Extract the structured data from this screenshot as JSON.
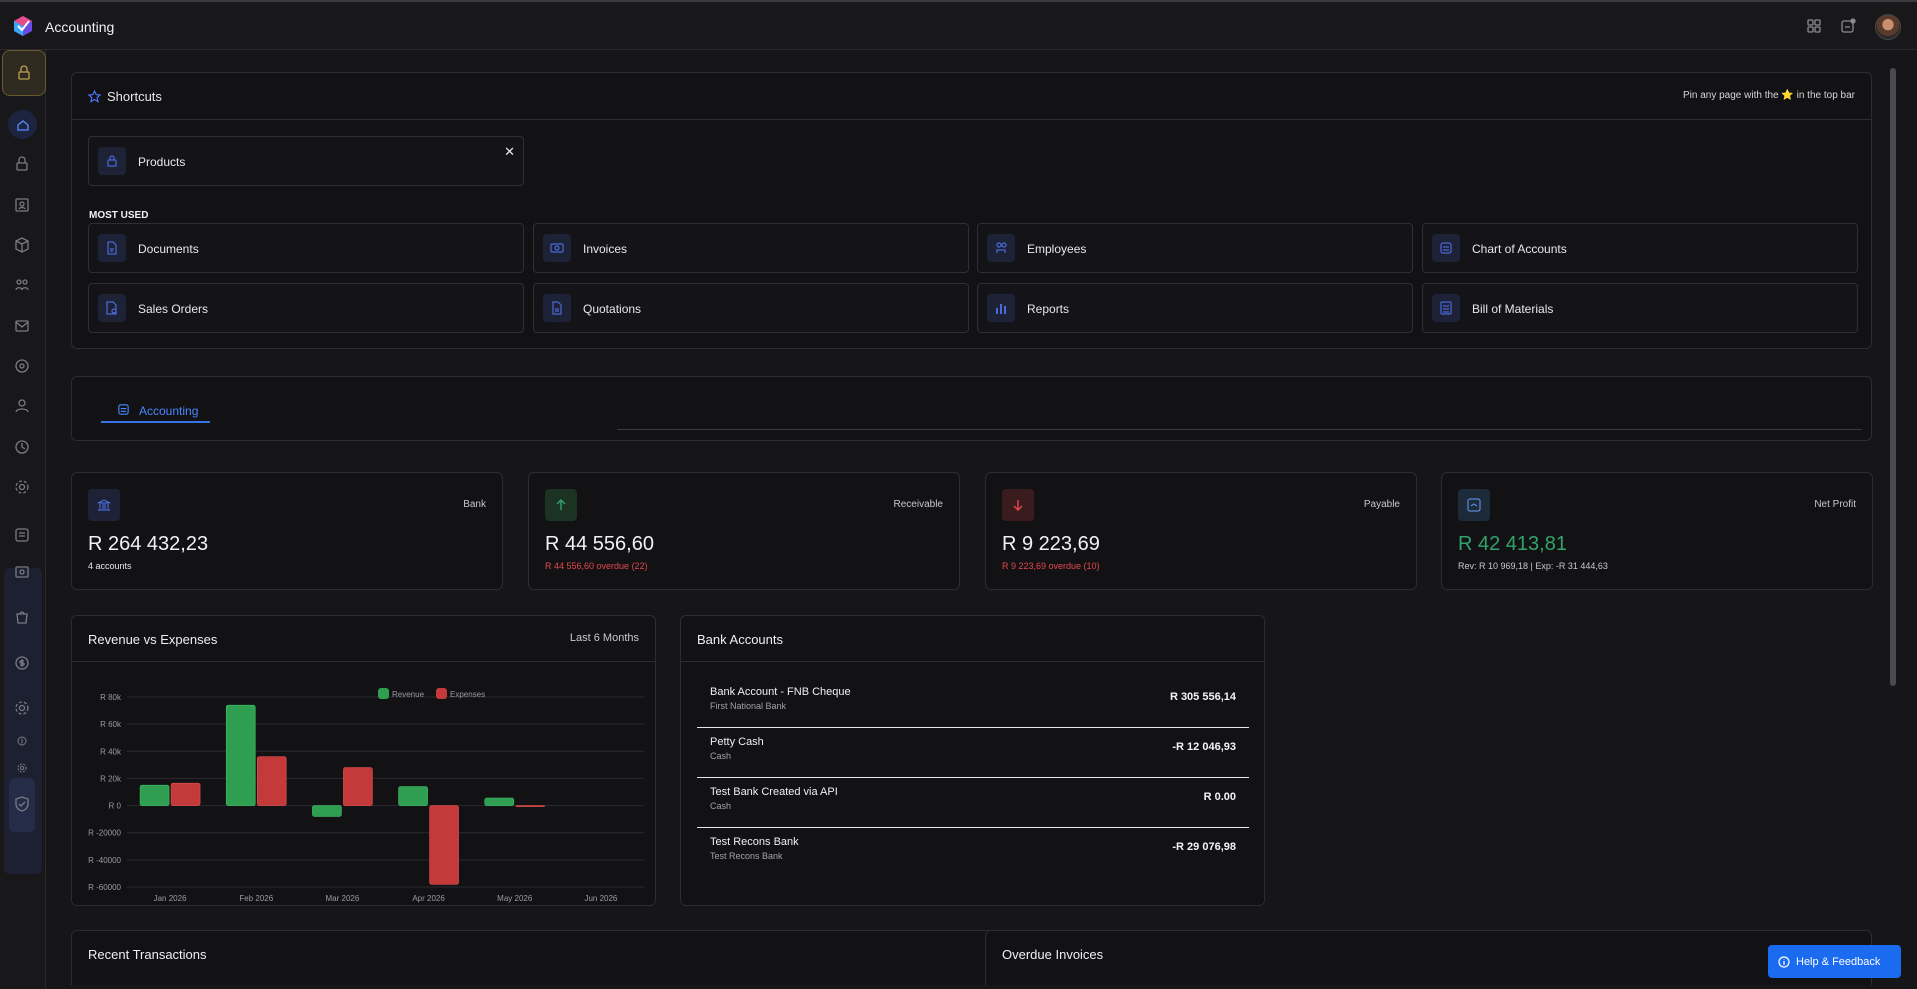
{
  "app": {
    "title": "Accounting"
  },
  "shortcuts": {
    "title": "Shortcuts",
    "hint": "Pin any page with the ⭐ in the top bar",
    "pinned": [
      {
        "label": "Products",
        "icon": "lock-icon"
      }
    ],
    "most_used_label": "MOST USED",
    "most_used": [
      {
        "label": "Documents",
        "icon": "document-icon"
      },
      {
        "label": "Invoices",
        "icon": "invoice-icon"
      },
      {
        "label": "Employees",
        "icon": "people-icon"
      },
      {
        "label": "Chart of Accounts",
        "icon": "ledger-icon"
      },
      {
        "label": "Sales Orders",
        "icon": "sales-order-icon"
      },
      {
        "label": "Quotations",
        "icon": "quotation-icon"
      },
      {
        "label": "Reports",
        "icon": "bar-chart-icon"
      },
      {
        "label": "Bill of Materials",
        "icon": "list-icon"
      }
    ]
  },
  "tabs": [
    {
      "label": "Accounting"
    }
  ],
  "stats": [
    {
      "label": "Bank",
      "value": "R 264 432,23",
      "sub": "4 accounts",
      "color": "#e8e8ea"
    },
    {
      "label": "Receivable",
      "value": "R 44 556,60",
      "sub": "R 44 556,60 overdue (22)",
      "color": "#e5484d"
    },
    {
      "label": "Payable",
      "value": "R 9 223,69",
      "sub": "R 9 223,69 overdue (10)",
      "color": "#e5484d"
    },
    {
      "label": "Net Profit",
      "value": "R 42 413,81",
      "sub": "Rev: R 10 969,18 | Exp: -R 31 444,63",
      "color": "#30a46c"
    }
  ],
  "revenue_chart": {
    "title": "Revenue vs Expenses",
    "range": "Last 6 Months"
  },
  "chart_data": {
    "type": "bar",
    "categories": [
      "Jan 2026",
      "Feb 2026",
      "Mar 2026",
      "Apr 2026",
      "May 2026",
      "Jun 2026"
    ],
    "series": [
      {
        "name": "Revenue",
        "values": [
          15000,
          74000,
          -8000,
          14000,
          5500,
          0
        ],
        "color": "#2f9e50"
      },
      {
        "name": "Expenses",
        "values": [
          16500,
          36000,
          28000,
          -58000,
          -500,
          0
        ],
        "color": "#c43a3a"
      }
    ],
    "yticks": [
      80000,
      60000,
      40000,
      20000,
      0,
      -20000,
      -40000,
      -60000
    ],
    "ytick_labels": [
      "R 80k",
      "R 60k",
      "R 40k",
      "R 20k",
      "R 0",
      "R -20000",
      "R -40000",
      "R -60000"
    ],
    "ylim": [
      -60000,
      80000
    ],
    "grid": true,
    "legend": "top-center"
  },
  "bank_accounts": {
    "title": "Bank Accounts",
    "rows": [
      {
        "name": "Bank Account - FNB Cheque",
        "sub": "First National Bank",
        "amount": "R 305 556,14"
      },
      {
        "name": "Petty Cash",
        "sub": "Cash",
        "amount": "-R 12 046,93"
      },
      {
        "name": "Test Bank Created via API",
        "sub": "Cash",
        "amount": "R 0.00"
      },
      {
        "name": "Test Recons Bank",
        "sub": "Test Recons Bank",
        "amount": "-R 29 076,98"
      }
    ]
  },
  "recent_transactions": {
    "title": "Recent Transactions"
  },
  "overdue_invoices": {
    "title": "Overdue Invoices"
  },
  "help": {
    "label": "Help & Feedback"
  }
}
